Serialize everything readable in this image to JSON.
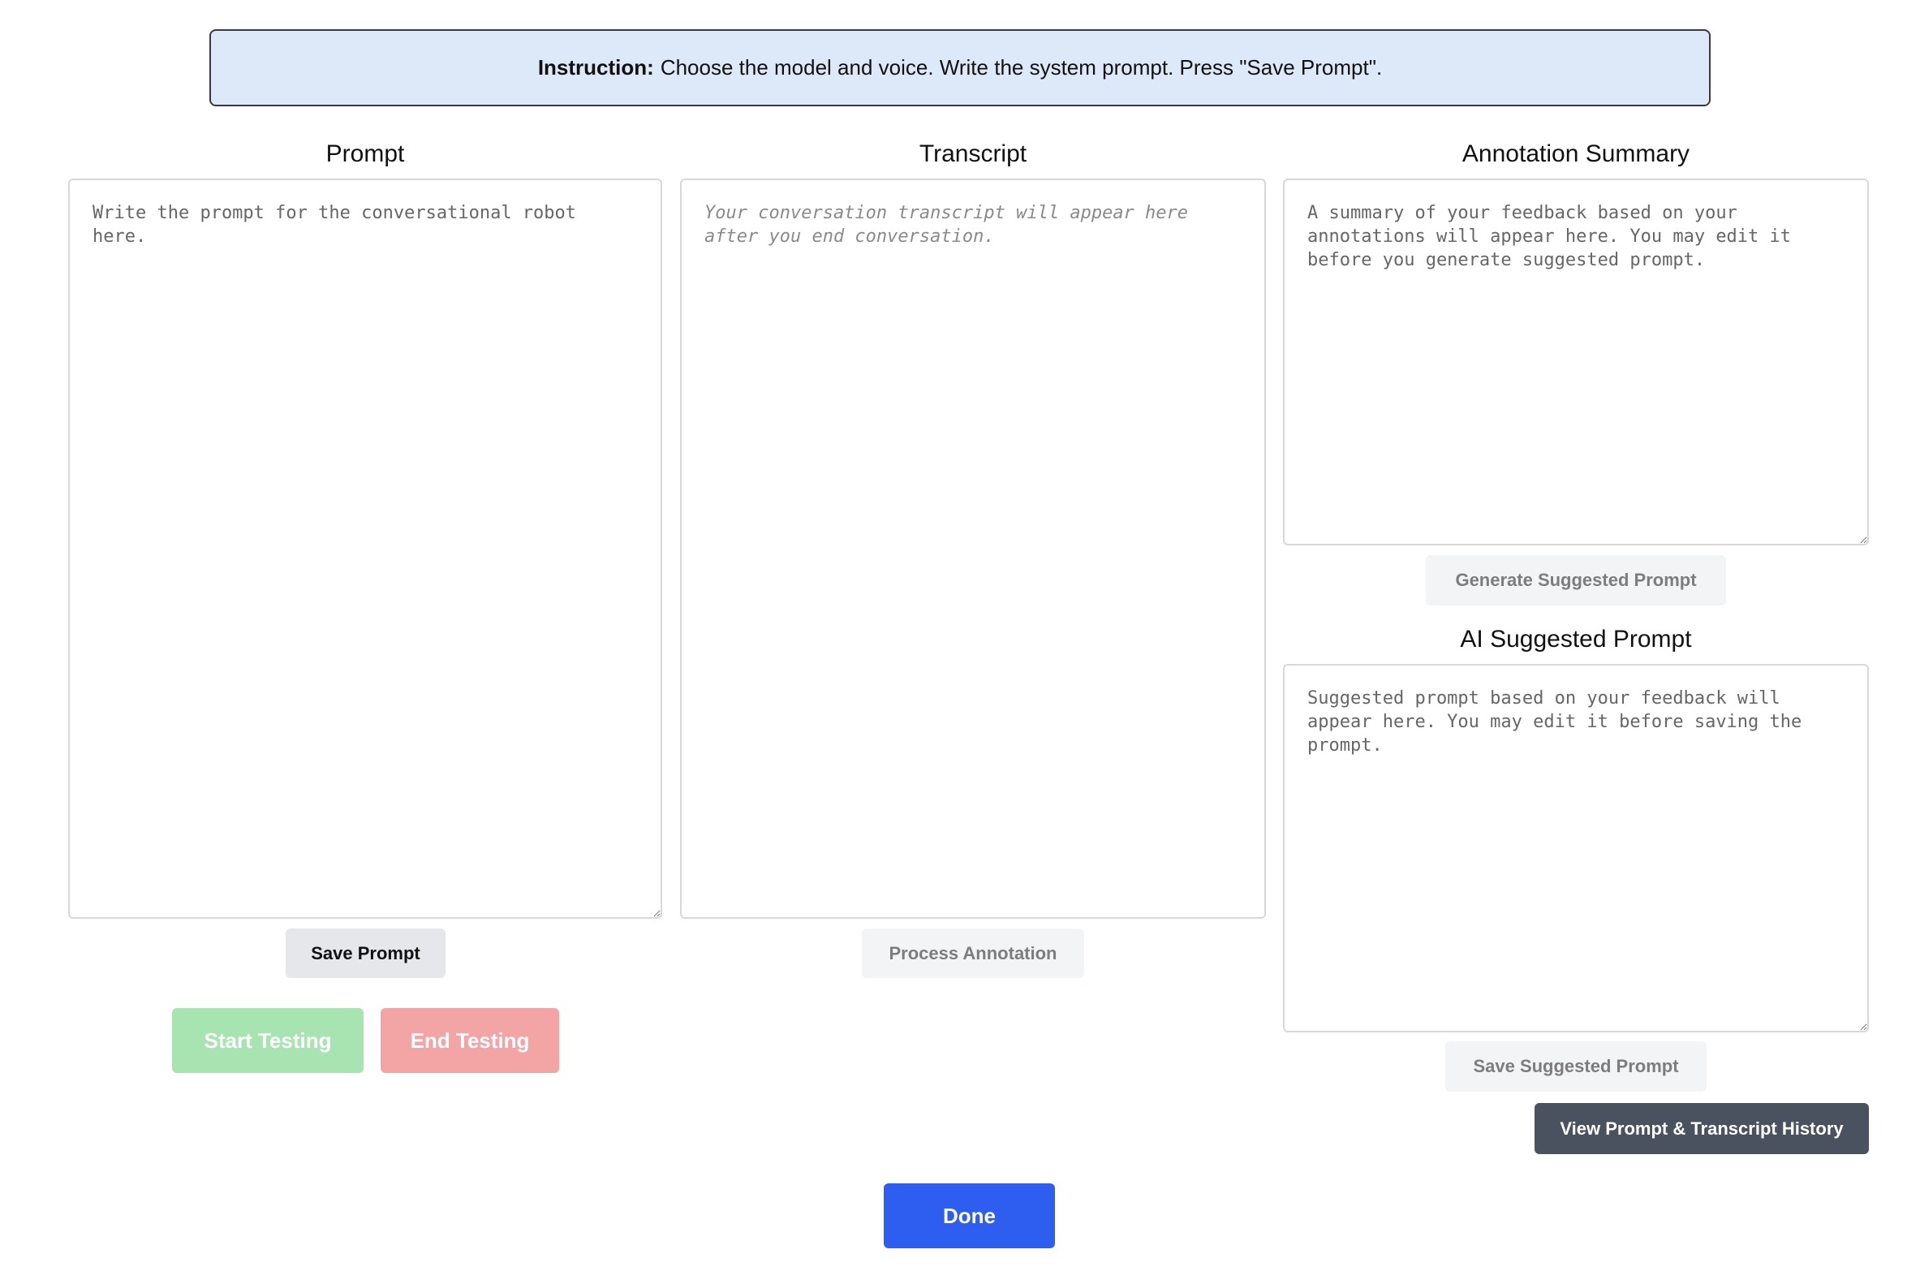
{
  "instruction": {
    "label": "Instruction:",
    "text": "Choose the model and voice. Write the system prompt. Press \"Save Prompt\"."
  },
  "prompt": {
    "title": "Prompt",
    "placeholder": "Write the prompt for the conversational robot here.",
    "save_button": "Save Prompt",
    "start_button": "Start Testing",
    "end_button": "End Testing"
  },
  "transcript": {
    "title": "Transcript",
    "placeholder": "Your conversation transcript will appear here after you end conversation.",
    "process_button": "Process Annotation"
  },
  "annotation_summary": {
    "title": "Annotation Summary",
    "placeholder": "A summary of your feedback based on your annotations will appear here. You may edit it before you generate suggested prompt.",
    "generate_button": "Generate Suggested Prompt"
  },
  "ai_suggested": {
    "title": "AI Suggested Prompt",
    "placeholder": "Suggested prompt based on your feedback will appear here. You may edit it before saving the prompt.",
    "save_button": "Save Suggested Prompt"
  },
  "history_button": "View Prompt & Transcript History",
  "done_button": "Done",
  "colors": {
    "instruction_bg": "#dde8f8",
    "start_green": "#a7e4b2",
    "end_red": "#f3a4a4",
    "history_dark": "#4a5260",
    "done_blue": "#2d5ef0"
  }
}
